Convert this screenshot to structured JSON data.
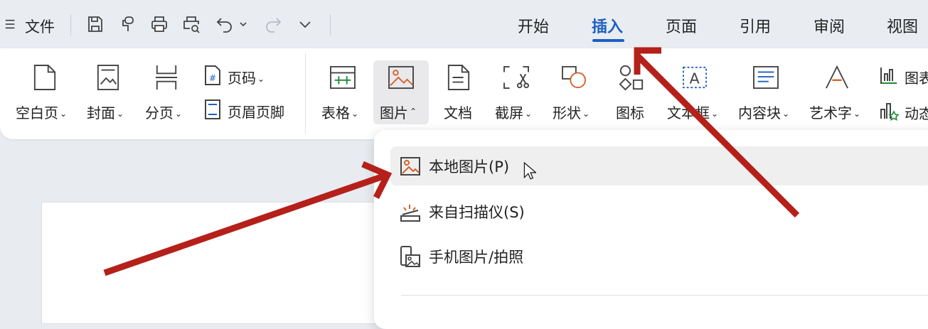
{
  "quick_access": {
    "menu_icon": "hamburger-menu-icon",
    "file_label": "文件",
    "tools": [
      "save-icon",
      "format-painter-icon",
      "print-icon",
      "print-preview-icon",
      "undo-icon",
      "redo-icon",
      "more-icon"
    ]
  },
  "tabs": {
    "items": [
      {
        "label": "开始",
        "active": false
      },
      {
        "label": "插入",
        "active": true
      },
      {
        "label": "页面",
        "active": false
      },
      {
        "label": "引用",
        "active": false
      },
      {
        "label": "审阅",
        "active": false
      },
      {
        "label": "视图",
        "active": false
      }
    ],
    "active_color": "#1f5fbf"
  },
  "ribbon": {
    "blank_page": "空白页",
    "cover": "封面",
    "page_break": "分页",
    "page_number": "页码",
    "header_footer": "页眉页脚",
    "table": "表格",
    "picture": "图片",
    "document": "文档",
    "screenshot": "截屏",
    "shapes": "形状",
    "icons": "图标",
    "text_box": "文本框",
    "content_block": "内容块",
    "word_art": "艺术字",
    "chart": "图表",
    "dynamic": "动态"
  },
  "picture_menu": {
    "items": [
      {
        "label": "本地图片(P)",
        "icon": "local-image-icon"
      },
      {
        "label": "来自扫描仪(S)",
        "icon": "scanner-icon"
      },
      {
        "label": "手机图片/拍照",
        "icon": "phone-image-icon"
      }
    ]
  },
  "annotation_color": "#b5201a",
  "accent_orange": "#d4622a"
}
